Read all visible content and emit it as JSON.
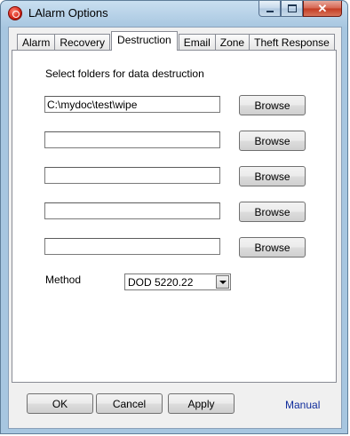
{
  "window": {
    "title": "LAlarm Options"
  },
  "tabs": [
    "Alarm",
    "Recovery",
    "Destruction",
    "Email",
    "Zone",
    "Theft Response"
  ],
  "destruction": {
    "heading": "Select folders for data destruction",
    "folders": [
      "C:\\mydoc\\test\\wipe",
      "",
      "",
      "",
      ""
    ],
    "browse_label": "Browse",
    "method_label": "Method",
    "method_value": "DOD 5220.22"
  },
  "footer": {
    "ok": "OK",
    "cancel": "Cancel",
    "apply": "Apply",
    "manual": "Manual"
  },
  "icons": {
    "app": "lalarm-icon",
    "minimize": "minimize-icon",
    "maximize": "maximize-icon",
    "close": "close-icon",
    "dropdown": "chevron-down-icon"
  }
}
